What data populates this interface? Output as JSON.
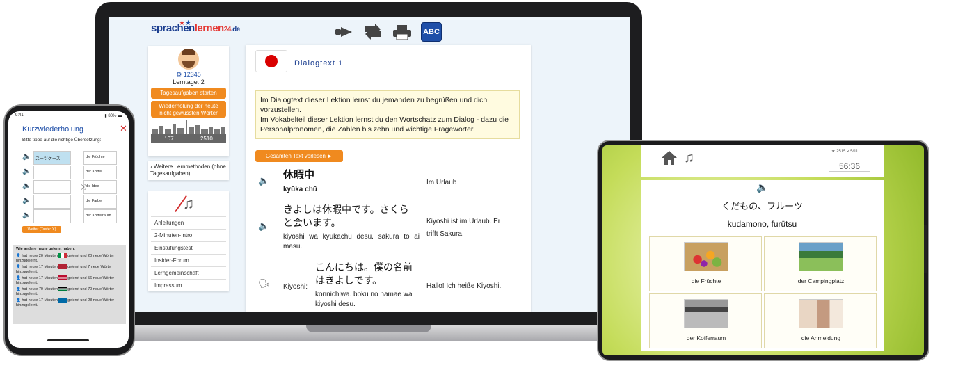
{
  "laptop": {
    "logo": {
      "part1": "sprachen",
      "part2": "lernen",
      "part3": "24",
      "part4": ".de"
    },
    "toolbar": {
      "abc_label": "ABC"
    },
    "profile": {
      "id": "⚙ 12345",
      "learning_days": "Lerntage: 2",
      "daily_tasks": "Tagesaufgaben starten",
      "repeat_words": "Wiederholung der heute nicht gewussten Wörter",
      "stat_left": "107",
      "stat_right": "2510"
    },
    "more_methods": "Weitere Lernmethoden (ohne Tagesaufgaben)",
    "links": [
      "Anleitungen",
      "2-Minuten-Intro",
      "Einstufungstest",
      "Insider-Forum",
      "Lerngemeinschaft",
      "Impressum"
    ],
    "dialog": {
      "title": "Dialogtext 1",
      "info_line1": "Im Dialogtext dieser Lektion lernst du jemanden zu begrüßen und dich vorzustellen.",
      "info_line2": "Im Vokabelteil dieser Lektion lernst du den Wortschatz zum Dialog - dazu die Personalpronomen, die Zahlen bis zehn und wichtige Fragewörter.",
      "read_all": "Gesamten Text vorlesen ►",
      "rows": [
        {
          "jp": "休暇中",
          "romaji": "kyūka chū",
          "de": "Im Urlaub"
        },
        {
          "jp": "きよしは休暇中です。さくらと会います。",
          "romaji": "kiyoshi wa kyūkachū desu. sakura to ai masu.",
          "de": "Kiyoshi ist im Urlaub. Er trifft Sakura."
        },
        {
          "speaker": "Kiyoshi:",
          "jp": "こんにちは。僕の名前はきよしです。",
          "romaji": "konnichiwa. boku no namae wa kiyoshi desu.",
          "de": "Hallo! Ich heiße Kiyoshi."
        }
      ]
    }
  },
  "phone": {
    "status_time": "9:41",
    "status_right": "▮ 80% ▬",
    "title": "Kurzwiederholung",
    "close": "✕",
    "subtitle": "Bitte tippe auf die richtige Übersetzung:",
    "left_items": [
      "スーツケース",
      "",
      "",
      "",
      ""
    ],
    "right_items": [
      "die Früchte",
      "der Koffer",
      "die Idee",
      "die Farbe",
      "der Kofferraum"
    ],
    "weiter": "Weiter (Taste: X)",
    "others_heading": "Wie andere heute gelernt haben:",
    "others": [
      {
        "pre": "hat heute 20 Minuten",
        "post": "gelernt und 20 neue Wörter hinzugelernt."
      },
      {
        "pre": "hat heute 17 Minuten",
        "post": "gelernt und 7 neue Wörter hinzugelernt."
      },
      {
        "pre": "hat heute 17 Minuten",
        "post": "gelernt und 56 neue Wörter hinzugelernt."
      },
      {
        "pre": "hat heute 70 Minuten",
        "post": "gelernt und 70 neue Wörter hinzugelernt."
      },
      {
        "pre": "hat heute 17 Minuten",
        "post": "gelernt und 28 neue Wörter hinzugelernt."
      }
    ]
  },
  "tablet": {
    "stats": "★ 2515 ✓5/11",
    "timer": "56:36",
    "jp": "くだもの、フルーツ",
    "romaji": "kudamono, furūtsu",
    "tiles": [
      "die Früchte",
      "der Campingplatz",
      "der Kofferraum",
      "die Anmeldung"
    ]
  },
  "colors": {
    "accent_orange": "#f08a1f",
    "brand_blue": "#1f4fa8",
    "japan_red": "#d90000"
  }
}
